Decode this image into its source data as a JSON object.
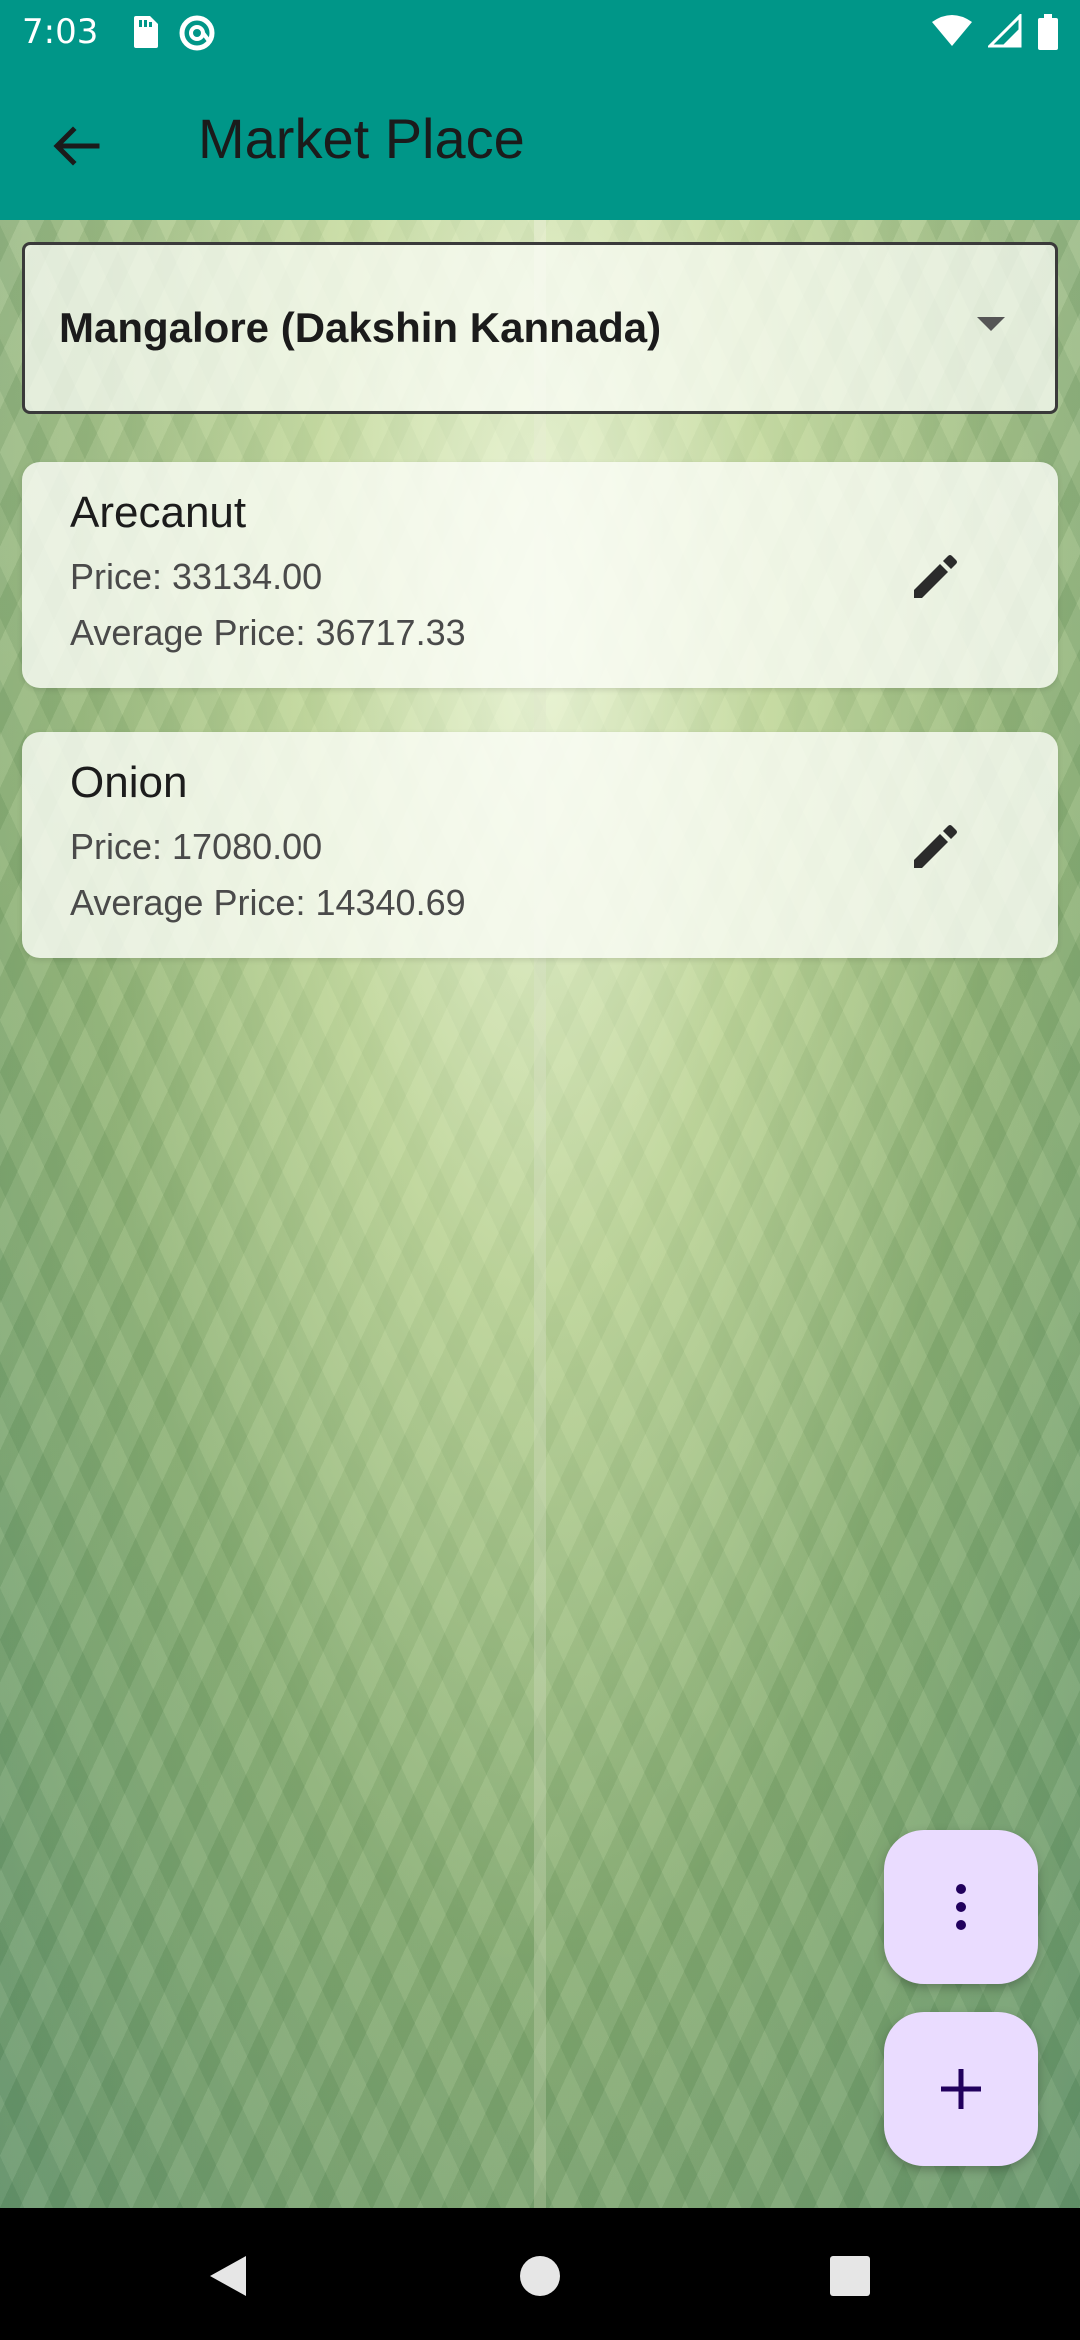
{
  "status_bar": {
    "time": "7:03",
    "left_icons": [
      "sd-card-icon",
      "at-sign-icon"
    ],
    "right_icons": [
      "wifi-icon",
      "signal-icon",
      "battery-icon"
    ]
  },
  "app_bar": {
    "title": "Market Place",
    "back_icon": "arrow-left-icon",
    "background": "#009688"
  },
  "dropdown": {
    "selected": "Mangalore (Dakshin Kannada)"
  },
  "items": [
    {
      "name": "Arecanut",
      "price": "Price: 33134.00",
      "average": "Average Price: 36717.33"
    },
    {
      "name": "Onion",
      "price": "Price: 17080.00",
      "average": "Average Price: 14340.69"
    }
  ],
  "fabs": {
    "more_icon": "more-vertical-icon",
    "add_icon": "plus-icon",
    "color": "#eadcff"
  },
  "nav_bar": {
    "icons": [
      "back-triangle-icon",
      "home-circle-icon",
      "recents-square-icon"
    ]
  }
}
